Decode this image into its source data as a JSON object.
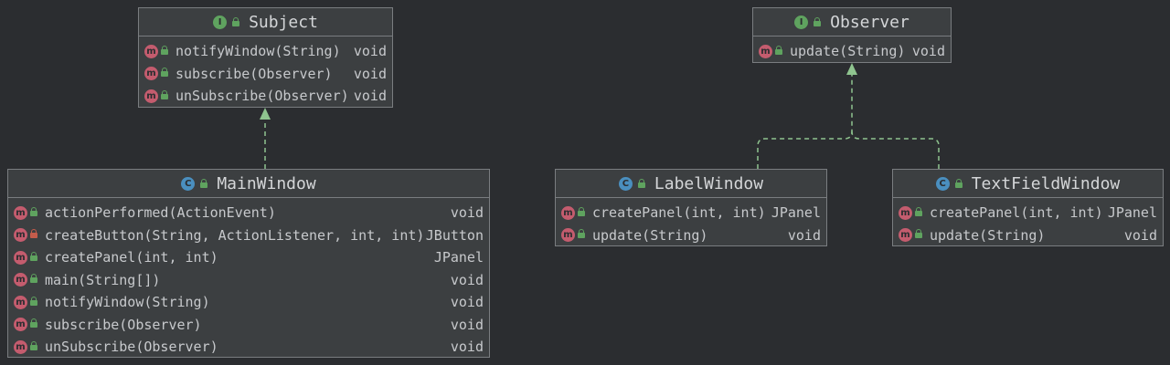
{
  "colors": {
    "background": "#2b2d30",
    "box_fill": "#3c3f41",
    "box_border": "#7a7d80",
    "edge": "#8fc48f",
    "method_icon": "#c45c6e",
    "interface_icon": "#5fa35f",
    "class_icon": "#4a8fbf"
  },
  "classes": {
    "subject": {
      "kind": "interface",
      "kind_glyph": "I",
      "name": "Subject",
      "methods": [
        {
          "name": "notifyWindow(String)",
          "type": "void",
          "access": "public"
        },
        {
          "name": "subscribe(Observer)",
          "type": "void",
          "access": "public"
        },
        {
          "name": "unSubscribe(Observer)",
          "type": "void",
          "access": "public"
        }
      ]
    },
    "observer": {
      "kind": "interface",
      "kind_glyph": "I",
      "name": "Observer",
      "methods": [
        {
          "name": "update(String)",
          "type": "void",
          "access": "public"
        }
      ]
    },
    "main_window": {
      "kind": "class",
      "kind_glyph": "C",
      "name": "MainWindow",
      "methods": [
        {
          "name": "actionPerformed(ActionEvent)",
          "type": "void",
          "access": "public"
        },
        {
          "name": "createButton(String, ActionListener, int, int)",
          "type": "JButton",
          "access": "private"
        },
        {
          "name": "createPanel(int, int)",
          "type": "JPanel",
          "access": "public"
        },
        {
          "name": "main(String[])",
          "type": "void",
          "access": "public"
        },
        {
          "name": "notifyWindow(String)",
          "type": "void",
          "access": "public"
        },
        {
          "name": "subscribe(Observer)",
          "type": "void",
          "access": "public"
        },
        {
          "name": "unSubscribe(Observer)",
          "type": "void",
          "access": "public"
        }
      ]
    },
    "label_window": {
      "kind": "class",
      "kind_glyph": "C",
      "name": "LabelWindow",
      "methods": [
        {
          "name": "createPanel(int, int)",
          "type": "JPanel",
          "access": "public"
        },
        {
          "name": "update(String)",
          "type": "void",
          "access": "public"
        }
      ]
    },
    "textfield_window": {
      "kind": "class",
      "kind_glyph": "C",
      "name": "TextFieldWindow",
      "methods": [
        {
          "name": "createPanel(int, int)",
          "type": "JPanel",
          "access": "public"
        },
        {
          "name": "update(String)",
          "type": "void",
          "access": "public"
        }
      ]
    }
  },
  "icons": {
    "method_glyph": "m",
    "method_icon": "method-icon",
    "public_icon": "public-lock-icon",
    "private_icon": "private-lock-icon"
  },
  "relations": [
    {
      "from": "MainWindow",
      "to": "Subject",
      "type": "implements"
    },
    {
      "from": "LabelWindow",
      "to": "Observer",
      "type": "implements"
    },
    {
      "from": "TextFieldWindow",
      "to": "Observer",
      "type": "implements"
    }
  ]
}
